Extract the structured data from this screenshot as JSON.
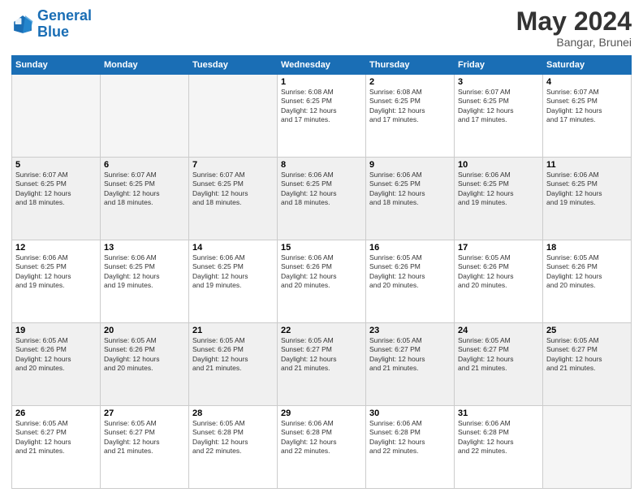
{
  "logo": {
    "line1": "General",
    "line2": "Blue"
  },
  "title": "May 2024",
  "location": "Bangar, Brunei",
  "days_of_week": [
    "Sunday",
    "Monday",
    "Tuesday",
    "Wednesday",
    "Thursday",
    "Friday",
    "Saturday"
  ],
  "weeks": [
    {
      "shaded": false,
      "days": [
        {
          "num": "",
          "info": "",
          "empty": true
        },
        {
          "num": "",
          "info": "",
          "empty": true
        },
        {
          "num": "",
          "info": "",
          "empty": true
        },
        {
          "num": "1",
          "info": "Sunrise: 6:08 AM\nSunset: 6:25 PM\nDaylight: 12 hours\nand 17 minutes.",
          "empty": false
        },
        {
          "num": "2",
          "info": "Sunrise: 6:08 AM\nSunset: 6:25 PM\nDaylight: 12 hours\nand 17 minutes.",
          "empty": false
        },
        {
          "num": "3",
          "info": "Sunrise: 6:07 AM\nSunset: 6:25 PM\nDaylight: 12 hours\nand 17 minutes.",
          "empty": false
        },
        {
          "num": "4",
          "info": "Sunrise: 6:07 AM\nSunset: 6:25 PM\nDaylight: 12 hours\nand 17 minutes.",
          "empty": false
        }
      ]
    },
    {
      "shaded": true,
      "days": [
        {
          "num": "5",
          "info": "Sunrise: 6:07 AM\nSunset: 6:25 PM\nDaylight: 12 hours\nand 18 minutes.",
          "empty": false
        },
        {
          "num": "6",
          "info": "Sunrise: 6:07 AM\nSunset: 6:25 PM\nDaylight: 12 hours\nand 18 minutes.",
          "empty": false
        },
        {
          "num": "7",
          "info": "Sunrise: 6:07 AM\nSunset: 6:25 PM\nDaylight: 12 hours\nand 18 minutes.",
          "empty": false
        },
        {
          "num": "8",
          "info": "Sunrise: 6:06 AM\nSunset: 6:25 PM\nDaylight: 12 hours\nand 18 minutes.",
          "empty": false
        },
        {
          "num": "9",
          "info": "Sunrise: 6:06 AM\nSunset: 6:25 PM\nDaylight: 12 hours\nand 18 minutes.",
          "empty": false
        },
        {
          "num": "10",
          "info": "Sunrise: 6:06 AM\nSunset: 6:25 PM\nDaylight: 12 hours\nand 19 minutes.",
          "empty": false
        },
        {
          "num": "11",
          "info": "Sunrise: 6:06 AM\nSunset: 6:25 PM\nDaylight: 12 hours\nand 19 minutes.",
          "empty": false
        }
      ]
    },
    {
      "shaded": false,
      "days": [
        {
          "num": "12",
          "info": "Sunrise: 6:06 AM\nSunset: 6:25 PM\nDaylight: 12 hours\nand 19 minutes.",
          "empty": false
        },
        {
          "num": "13",
          "info": "Sunrise: 6:06 AM\nSunset: 6:25 PM\nDaylight: 12 hours\nand 19 minutes.",
          "empty": false
        },
        {
          "num": "14",
          "info": "Sunrise: 6:06 AM\nSunset: 6:25 PM\nDaylight: 12 hours\nand 19 minutes.",
          "empty": false
        },
        {
          "num": "15",
          "info": "Sunrise: 6:06 AM\nSunset: 6:26 PM\nDaylight: 12 hours\nand 20 minutes.",
          "empty": false
        },
        {
          "num": "16",
          "info": "Sunrise: 6:05 AM\nSunset: 6:26 PM\nDaylight: 12 hours\nand 20 minutes.",
          "empty": false
        },
        {
          "num": "17",
          "info": "Sunrise: 6:05 AM\nSunset: 6:26 PM\nDaylight: 12 hours\nand 20 minutes.",
          "empty": false
        },
        {
          "num": "18",
          "info": "Sunrise: 6:05 AM\nSunset: 6:26 PM\nDaylight: 12 hours\nand 20 minutes.",
          "empty": false
        }
      ]
    },
    {
      "shaded": true,
      "days": [
        {
          "num": "19",
          "info": "Sunrise: 6:05 AM\nSunset: 6:26 PM\nDaylight: 12 hours\nand 20 minutes.",
          "empty": false
        },
        {
          "num": "20",
          "info": "Sunrise: 6:05 AM\nSunset: 6:26 PM\nDaylight: 12 hours\nand 20 minutes.",
          "empty": false
        },
        {
          "num": "21",
          "info": "Sunrise: 6:05 AM\nSunset: 6:26 PM\nDaylight: 12 hours\nand 21 minutes.",
          "empty": false
        },
        {
          "num": "22",
          "info": "Sunrise: 6:05 AM\nSunset: 6:27 PM\nDaylight: 12 hours\nand 21 minutes.",
          "empty": false
        },
        {
          "num": "23",
          "info": "Sunrise: 6:05 AM\nSunset: 6:27 PM\nDaylight: 12 hours\nand 21 minutes.",
          "empty": false
        },
        {
          "num": "24",
          "info": "Sunrise: 6:05 AM\nSunset: 6:27 PM\nDaylight: 12 hours\nand 21 minutes.",
          "empty": false
        },
        {
          "num": "25",
          "info": "Sunrise: 6:05 AM\nSunset: 6:27 PM\nDaylight: 12 hours\nand 21 minutes.",
          "empty": false
        }
      ]
    },
    {
      "shaded": false,
      "days": [
        {
          "num": "26",
          "info": "Sunrise: 6:05 AM\nSunset: 6:27 PM\nDaylight: 12 hours\nand 21 minutes.",
          "empty": false
        },
        {
          "num": "27",
          "info": "Sunrise: 6:05 AM\nSunset: 6:27 PM\nDaylight: 12 hours\nand 21 minutes.",
          "empty": false
        },
        {
          "num": "28",
          "info": "Sunrise: 6:05 AM\nSunset: 6:28 PM\nDaylight: 12 hours\nand 22 minutes.",
          "empty": false
        },
        {
          "num": "29",
          "info": "Sunrise: 6:06 AM\nSunset: 6:28 PM\nDaylight: 12 hours\nand 22 minutes.",
          "empty": false
        },
        {
          "num": "30",
          "info": "Sunrise: 6:06 AM\nSunset: 6:28 PM\nDaylight: 12 hours\nand 22 minutes.",
          "empty": false
        },
        {
          "num": "31",
          "info": "Sunrise: 6:06 AM\nSunset: 6:28 PM\nDaylight: 12 hours\nand 22 minutes.",
          "empty": false
        },
        {
          "num": "",
          "info": "",
          "empty": true
        }
      ]
    }
  ]
}
